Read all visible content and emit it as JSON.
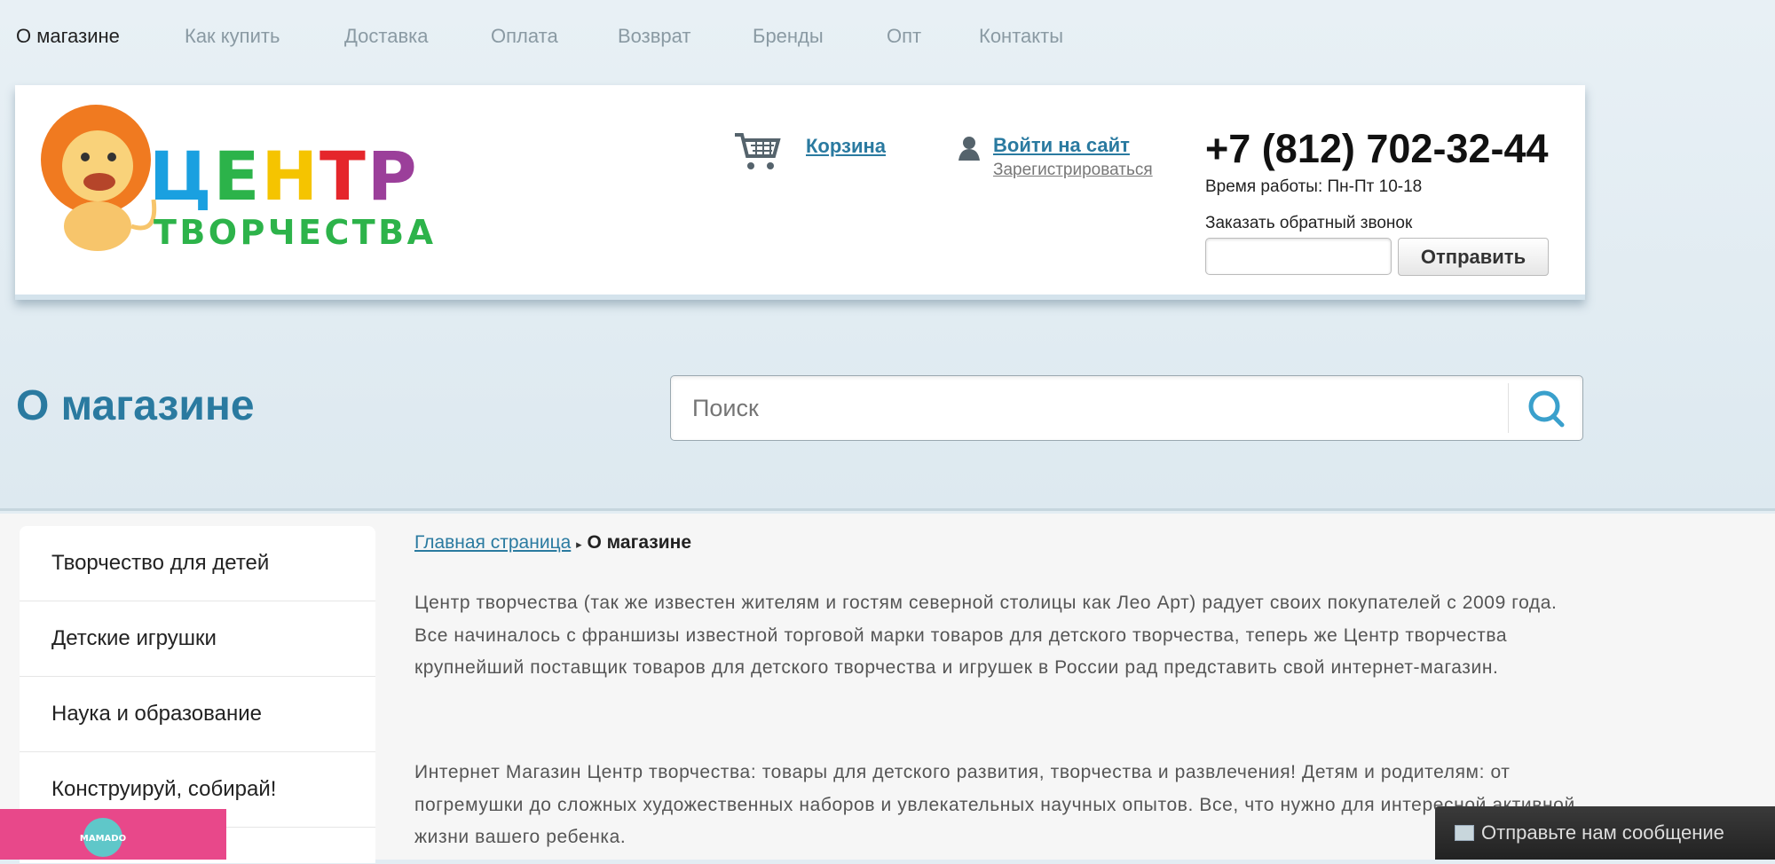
{
  "top_nav": [
    {
      "label": "О магазине",
      "active": true
    },
    {
      "label": "Как купить"
    },
    {
      "label": "Доставка"
    },
    {
      "label": "Оплата"
    },
    {
      "label": "Возврат"
    },
    {
      "label": "Бренды"
    },
    {
      "label": "Опт"
    },
    {
      "label": "Контакты"
    }
  ],
  "header": {
    "logo": {
      "line1": "ЦЕНТР",
      "line2": "ТВОРЧЕСТВА",
      "letter_colors": [
        "#1aa0e0",
        "#2cb34a",
        "#f5c400",
        "#e5262b",
        "#9b3f9a"
      ],
      "line2_color": "#2db34a"
    },
    "cart_label": "Корзина",
    "login_label": "Войти на сайт",
    "register_label": "Зарегистрироваться",
    "phone": "+7 (812) 702-32-44",
    "hours": "Время работы: Пн-Пт 10-18",
    "callback_label": "Заказать обратный звонок",
    "callback_value": "",
    "send_label": "Отправить"
  },
  "page_title": "О магазине",
  "search": {
    "placeholder": "Поиск"
  },
  "sidebar": {
    "items": [
      {
        "label": "Творчество для детей"
      },
      {
        "label": "Детские игрушки"
      },
      {
        "label": "Наука и образование"
      },
      {
        "label": "Конструируй, собирай!"
      }
    ]
  },
  "breadcrumb": {
    "home": "Главная страница",
    "separator": "▸",
    "current": "О магазине"
  },
  "content": {
    "paragraphs": [
      "Центр творчества (так же известен жителям и гостям северной столицы как Лео Арт) радует своих покупателей с 2009 года. Все начиналось с франшизы известной торговой марки товаров для детского творчества, теперь же Центр творчества крупнейший поставщик товаров для детского творчества и игрушек в России рад представить свой интернет-магазин.",
      "Интернет Магазин Центр творчества: товары для детского развития, творчества и развлечения! Детям и родителям: от погремушки до сложных художественных наборов и увлекательных научных опытов. Все, что нужно для интересной активной жизни вашего ребенка."
    ]
  },
  "widget": {
    "brand": "MAMADO",
    "brand_color": "#e8488a"
  },
  "message_button": "Отправьте нам сообщение",
  "colors": {
    "accent": "#2a7aa0",
    "search_icon": "#3aa0cc"
  }
}
